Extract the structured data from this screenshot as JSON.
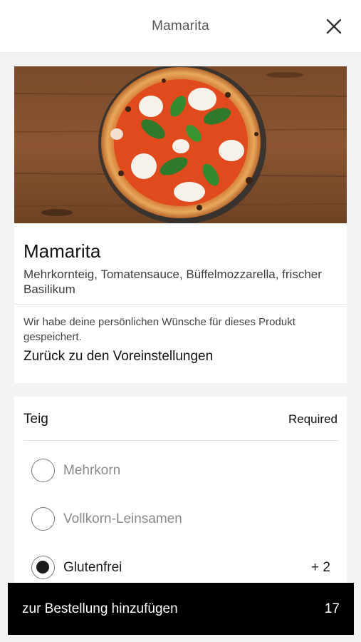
{
  "header": {
    "title": "Mamarita",
    "close_icon": "close-icon"
  },
  "product": {
    "image_icon": "pizza-margherita-image",
    "name": "Mamarita",
    "description": "Mehrkornteig, Tomatensauce, Büffelmozzarella, frischer Basilikum",
    "saved_note": "Wir habe deine persönlichen Wünsche für dieses Produkt gespeichert.",
    "reset_link": "Zurück zu den Voreinstellungen"
  },
  "options": {
    "title": "Teig",
    "requirement": "Required",
    "items": [
      {
        "label": "Mehrkorn",
        "selected": false,
        "price": ""
      },
      {
        "label": "Vollkorn-Leinsamen",
        "selected": false,
        "price": ""
      },
      {
        "label": "Glutenfrei",
        "selected": true,
        "price": "+ 2"
      }
    ]
  },
  "cart": {
    "label": "zur Bestellung hinzufügen",
    "total": "17"
  },
  "colors": {
    "cta_background": "#000000",
    "page_background": "#f3f3f3",
    "card_background": "#ffffff"
  }
}
